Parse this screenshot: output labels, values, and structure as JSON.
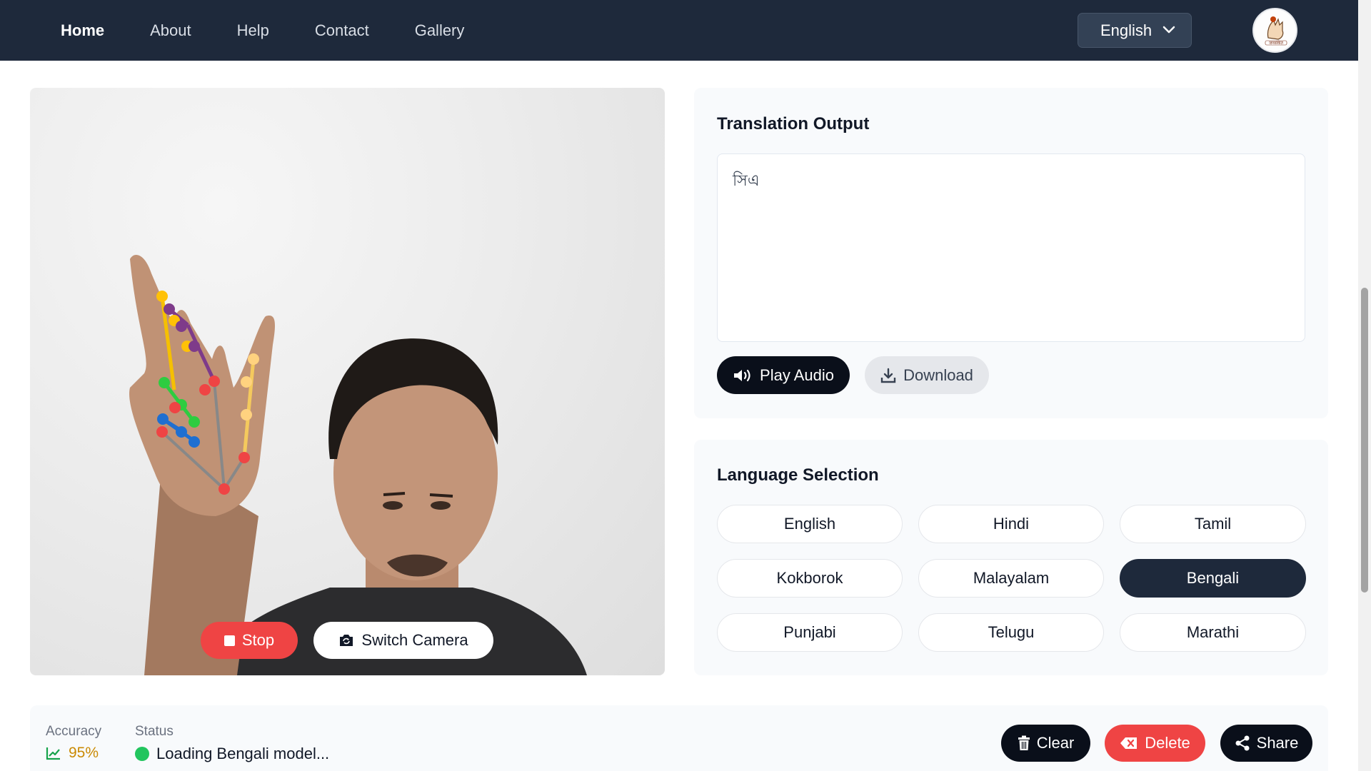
{
  "nav": {
    "links": [
      "Home",
      "About",
      "Help",
      "Contact",
      "Gallery"
    ],
    "active": "Home",
    "language_select": "English",
    "logo_text": "जनसंकेत"
  },
  "camera": {
    "stop_label": "Stop",
    "switch_label": "Switch Camera"
  },
  "translation": {
    "title": "Translation Output",
    "output_text": "সিএ",
    "play_label": "Play Audio",
    "download_label": "Download"
  },
  "language_selection": {
    "title": "Language Selection",
    "options": [
      "English",
      "Hindi",
      "Tamil",
      "Kokborok",
      "Malayalam",
      "Bengali",
      "Punjabi",
      "Telugu",
      "Marathi"
    ],
    "selected": "Bengali"
  },
  "status_bar": {
    "accuracy_label": "Accuracy",
    "accuracy_value": "95%",
    "status_label": "Status",
    "status_value": "Loading Bengali model...",
    "clear_label": "Clear",
    "delete_label": "Delete",
    "share_label": "Share"
  },
  "colors": {
    "nav_bg": "#1e293b",
    "primary_dark": "#0a0f1a",
    "danger": "#ef4444",
    "accuracy": "#ca8a04",
    "status_ok": "#22c55e"
  }
}
